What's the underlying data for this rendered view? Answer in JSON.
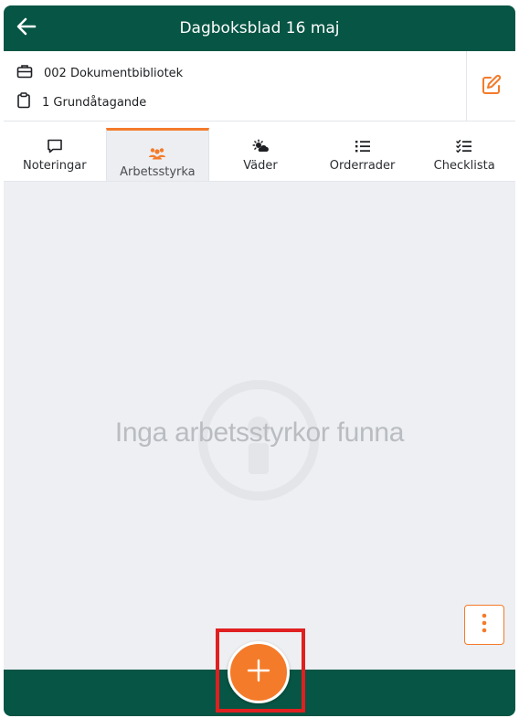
{
  "header": {
    "title": "Dagboksblad 16 maj",
    "back_icon": "arrow-left-icon"
  },
  "info": {
    "project_label": "002 Dokumentbibliotek",
    "project_icon": "briefcase-icon",
    "stage_label": "1 Grundåtagande",
    "stage_icon": "clipboard-icon",
    "edit_icon": "edit-icon"
  },
  "tabs": [
    {
      "label": "Noteringar",
      "icon": "comment-icon",
      "active": false
    },
    {
      "label": "Arbetsstyrka",
      "icon": "users-icon",
      "active": true
    },
    {
      "label": "Väder",
      "icon": "weather-icon",
      "active": false
    },
    {
      "label": "Orderrader",
      "icon": "list-icon",
      "active": false
    },
    {
      "label": "Checklista",
      "icon": "checklist-icon",
      "active": false
    }
  ],
  "empty_state": {
    "message": "Inga arbetsstyrkor funna",
    "icon": "info-icon"
  },
  "actions": {
    "more_icon": "more-vertical-icon",
    "add_icon": "plus-icon"
  },
  "colors": {
    "brand_green": "#075544",
    "accent_orange": "#f47b2a",
    "highlight_red": "#e02020"
  }
}
